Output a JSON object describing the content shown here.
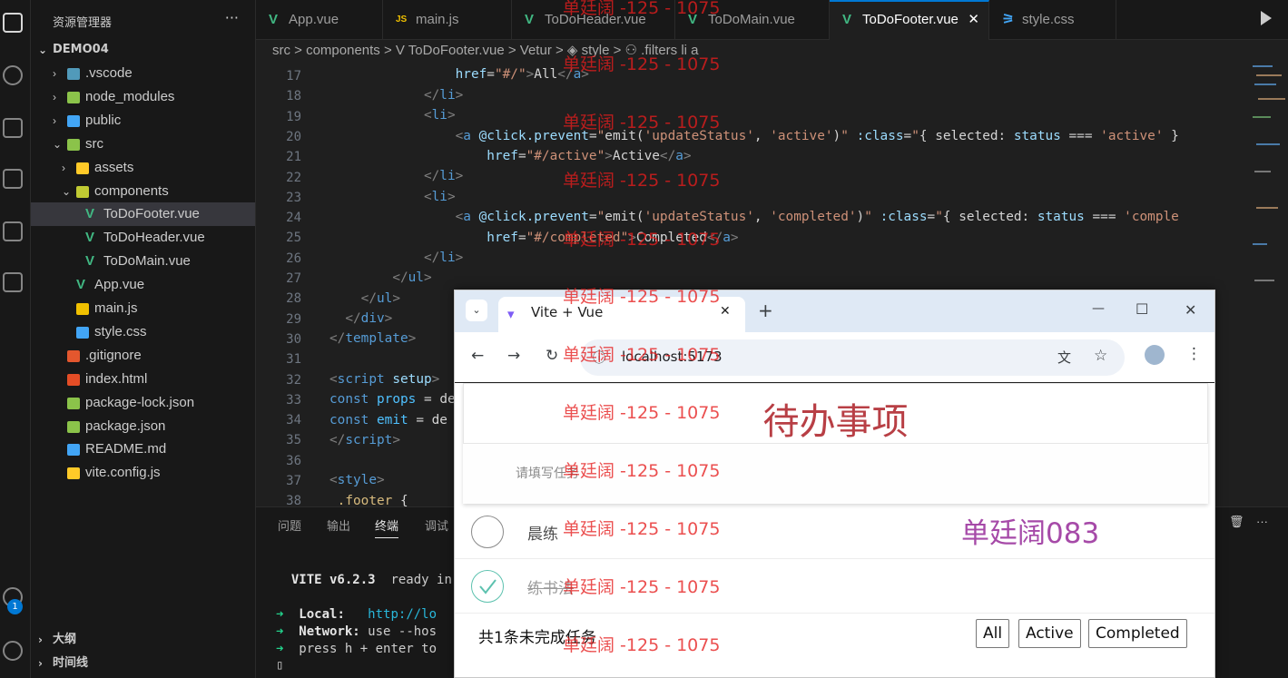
{
  "explorer": {
    "title": "资源管理器",
    "menu_glyph": "···",
    "project": "DEMO04",
    "items": [
      {
        "label": ".vscode",
        "chevron": "›",
        "color": "#519aba"
      },
      {
        "label": "node_modules",
        "chevron": "›",
        "color": "#8bc34a"
      },
      {
        "label": "public",
        "chevron": "›",
        "color": "#42a5f5"
      },
      {
        "label": "src",
        "chevron": "⌄",
        "color": "#8bc34a"
      },
      {
        "label": "assets",
        "chevron": "›",
        "color": "#ffca28"
      },
      {
        "label": "components",
        "chevron": "⌄",
        "color": "#c0ca33"
      },
      {
        "label": "ToDoFooter.vue",
        "glyph": "V"
      },
      {
        "label": "ToDoHeader.vue",
        "glyph": "V"
      },
      {
        "label": "ToDoMain.vue",
        "glyph": "V"
      },
      {
        "label": "App.vue",
        "glyph": "V"
      },
      {
        "label": "main.js",
        "color": "#f0c000"
      },
      {
        "label": "style.css",
        "color": "#42a5f5"
      },
      {
        "label": ".gitignore",
        "color": "#e4572e"
      },
      {
        "label": "index.html",
        "color": "#e44d26"
      },
      {
        "label": "package-lock.json",
        "color": "#8bc34a"
      },
      {
        "label": "package.json",
        "color": "#8bc34a"
      },
      {
        "label": "README.md",
        "color": "#42a5f5"
      },
      {
        "label": "vite.config.js",
        "color": "#ffca28"
      }
    ],
    "outline_label": "大纲",
    "timeline_label": "时间线",
    "badge_count": "1"
  },
  "tabs": [
    {
      "label": "App.vue",
      "icon": "V"
    },
    {
      "label": "main.js",
      "icon": "JS"
    },
    {
      "label": "ToDoHeader.vue",
      "icon": "V"
    },
    {
      "label": "ToDoMain.vue",
      "icon": "V"
    },
    {
      "label": "ToDoFooter.vue",
      "icon": "V",
      "close": "✕"
    },
    {
      "label": "style.css",
      "icon": "⚞"
    }
  ],
  "breadcrumb": "src > components > V ToDoFooter.vue > Vetur > ◈ style > ⚇ .filters li a",
  "editor": {
    "line_numbers": [
      "17",
      "18",
      "19",
      "20",
      "21",
      "22",
      "23",
      "24",
      "25",
      "26",
      "27",
      "28",
      "29",
      "30",
      "31",
      "32",
      "33",
      "34",
      "35",
      "36",
      "37",
      "38"
    ]
  },
  "panel": {
    "tabs": [
      "问题",
      "输出",
      "终端",
      "调试"
    ],
    "vite_version": "VITE v6.2.3",
    "ready": "ready in",
    "local_label": "Local:",
    "local_url": "http://lo",
    "network_label": "Network:",
    "network_text": "use --hos",
    "press_text": "press h + enter to",
    "prompt": "▯"
  },
  "browser": {
    "tab_title": "Vite + Vue",
    "tab_close": "✕",
    "new_tab": "+",
    "url": "localhost:5173",
    "min": "—",
    "max": "☐",
    "close": "✕"
  },
  "app": {
    "title": "待办事项",
    "input_placeholder": "请填写任务",
    "todos": [
      {
        "text": "晨练",
        "done": false
      },
      {
        "text": "练书法",
        "done": true
      }
    ],
    "footer_count": "共1条未完成任务",
    "filters": [
      "All",
      "Active",
      "Completed"
    ]
  },
  "watermark_text": "单廷阔 -125 - 1075",
  "user_mark": "单廷阔083"
}
